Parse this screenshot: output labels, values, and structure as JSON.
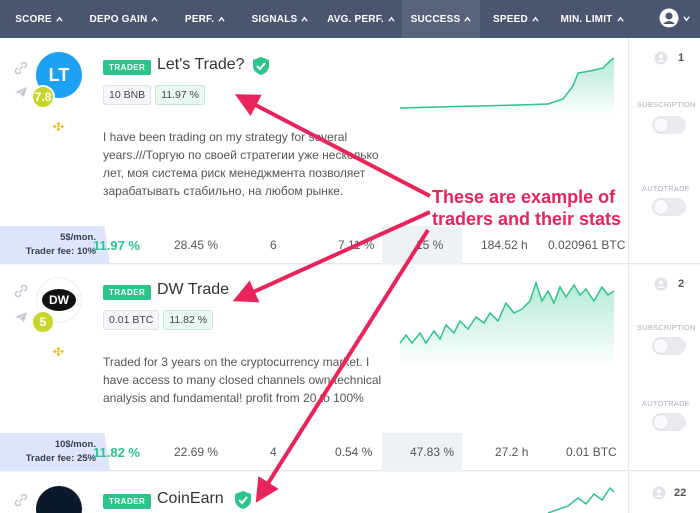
{
  "header": {
    "columns": [
      {
        "label": "SCORE"
      },
      {
        "label": "DEPO GAIN"
      },
      {
        "label": "PERF."
      },
      {
        "label": "SIGNALS"
      },
      {
        "label": "AVG. PERF."
      },
      {
        "label": "SUCCESS"
      },
      {
        "label": "SPEED"
      },
      {
        "label": "MIN. LIMIT"
      }
    ]
  },
  "traders": [
    {
      "badge": "TRADER",
      "name": "Let's Trade?",
      "avatar_text": "LT",
      "score": "7.8",
      "verified": true,
      "tag_amount": "10 BNB",
      "tag_gain": "11.97 %",
      "description": "I have been trading on my strategy for several years.///Торгую по своей стратегии уже несколько лет, моя система риск менеджмента позволяет зарабатывать стабильно, на любом рынке.",
      "fee_price": "5$/mon.",
      "fee_label": "Trader fee: 10%",
      "depo_gain": "11.97 %",
      "perf": "28.45 %",
      "signals": "6",
      "avg_perf": "7.11 %",
      "success": "15 %",
      "speed": "184.52 h",
      "min_limit": "0.020961 BTC",
      "subscribers": "1",
      "subscription_label": "SUBSCRIPTION",
      "autotrade_label": "AUTOTRADE"
    },
    {
      "badge": "TRADER",
      "name": "DW Trade",
      "avatar_text": "DW",
      "score": "5",
      "verified": false,
      "tag_amount": "0.01 BTC",
      "tag_gain": "11.82 %",
      "description": "Traded for 3 years on the cryptocurrency market. I have access to many closed channels own technical analysis and fundamental! profit from 20 to 100%",
      "fee_price": "10$/mon.",
      "fee_label": "Trader fee: 25%",
      "depo_gain": "11.82 %",
      "perf": "22.69 %",
      "signals": "4",
      "avg_perf": "0.54 %",
      "success": "47.83 %",
      "speed": "27.2 h",
      "min_limit": "0.01 BTC",
      "subscribers": "2",
      "subscription_label": "SUBSCRIPTION",
      "autotrade_label": "AUTOTRADE"
    },
    {
      "badge": "TRADER",
      "name": "CoinEarn",
      "verified": true,
      "subscribers": "22"
    }
  ],
  "annotation": "These are example of traders and their stats",
  "colors": {
    "header_bg": "#4a5670",
    "accent_green": "#2bc48a",
    "score_badge": "#c6d72a",
    "annotation": "#e8245a",
    "avatar_lt": "#1da1f2"
  }
}
